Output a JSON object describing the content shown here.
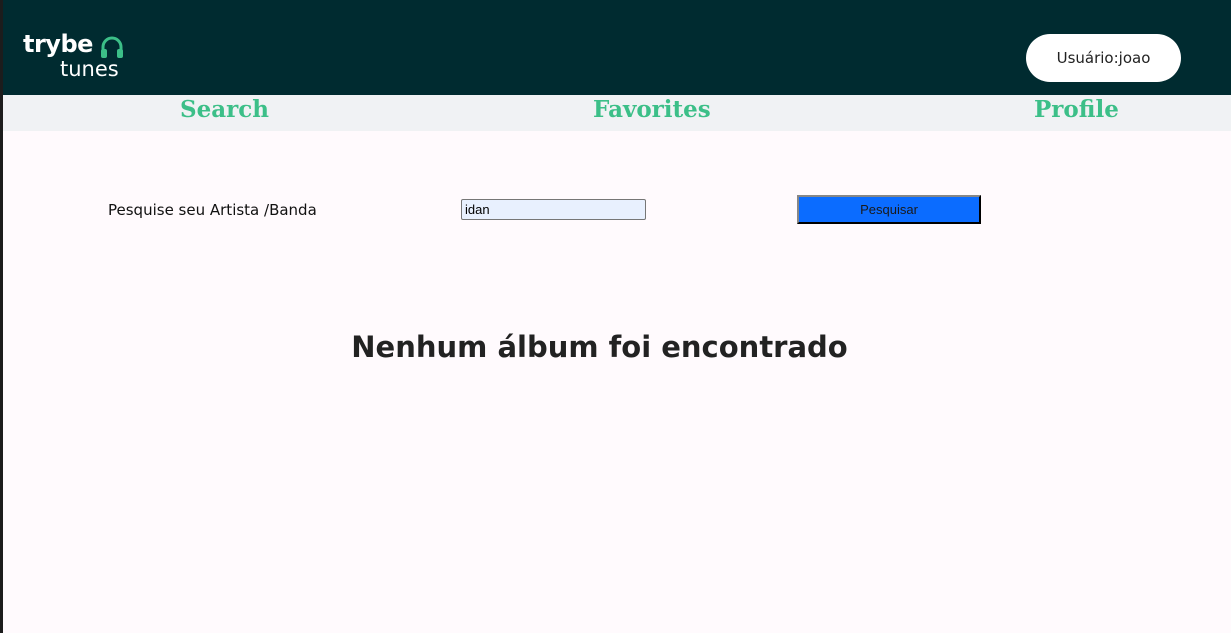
{
  "header": {
    "logo_top": "trybe",
    "logo_bottom": "tunes",
    "user_label": "Usuário:joao"
  },
  "nav": {
    "items": [
      {
        "label": "Search"
      },
      {
        "label": "Favorites"
      },
      {
        "label": "Profile"
      }
    ]
  },
  "search": {
    "label": "Pesquise seu Artista /Banda",
    "value": "idan",
    "button_label": "Pesquisar"
  },
  "results": {
    "empty_message": "Nenhum álbum foi encontrado"
  },
  "icons": {
    "logo_icon": "headphones-icon"
  },
  "colors": {
    "header_bg": "#002b30",
    "nav_link": "#3cbf88",
    "search_button": "#0b6cff"
  }
}
